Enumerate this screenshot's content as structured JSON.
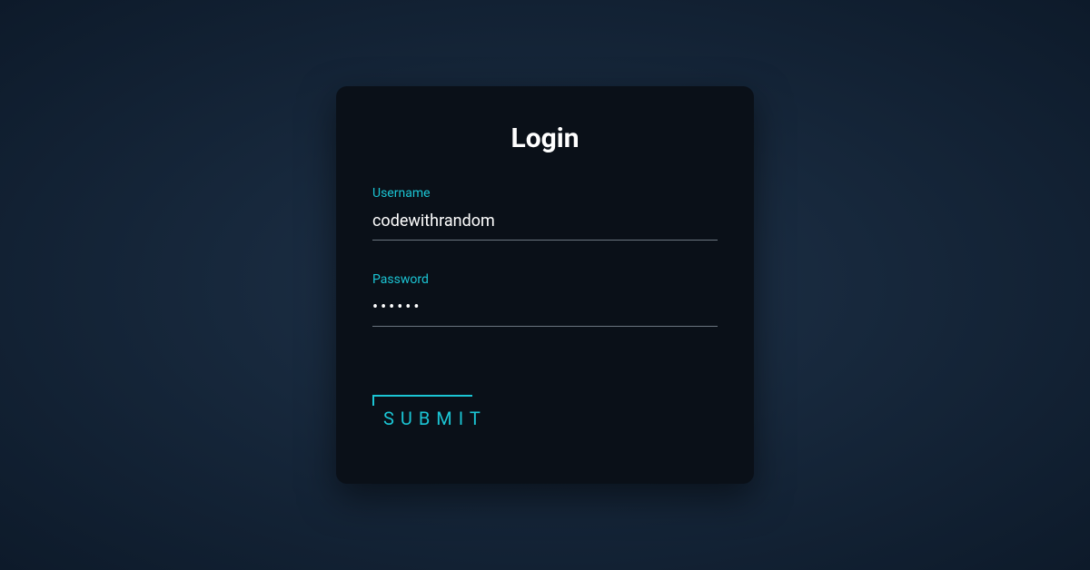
{
  "form": {
    "title": "Login",
    "username": {
      "label": "Username",
      "value": "codewithrandom"
    },
    "password": {
      "label": "Password",
      "value": "••••••"
    },
    "submit": {
      "label": "SUBMIT"
    }
  },
  "colors": {
    "accent": "#1bc5d4",
    "panel_bg": "#0a1018",
    "page_bg_from": "#1e3249",
    "page_bg_to": "#0d1a2a"
  }
}
